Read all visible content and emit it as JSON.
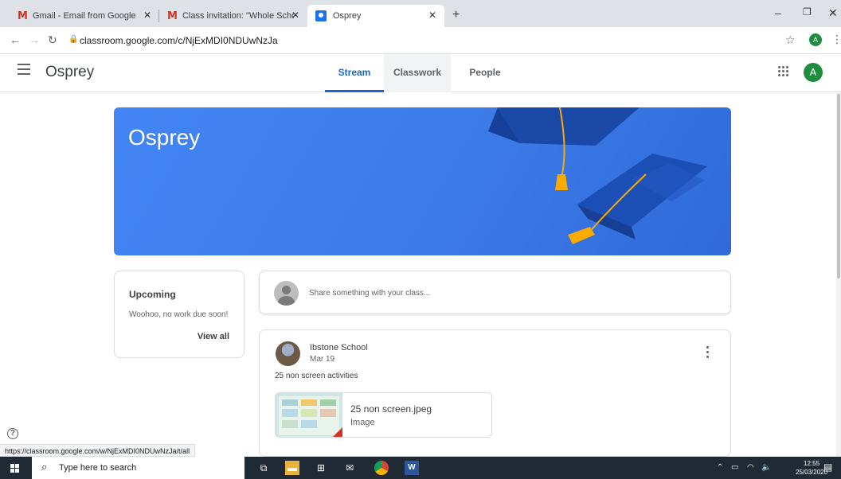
{
  "browser": {
    "tabs": [
      {
        "title": "Gmail - Email from Google",
        "icon": "gmail-icon"
      },
      {
        "title": "Class invitation: \"Whole School\" -",
        "icon": "gmail-icon"
      },
      {
        "title": "Osprey",
        "icon": "classroom-icon",
        "active": true
      }
    ],
    "new_tab": "+",
    "url": "classroom.google.com/c/NjExMDI0NDUwNzJa",
    "profile_initial": "A"
  },
  "header": {
    "class_name": "Osprey",
    "tabs": [
      {
        "label": "Stream",
        "active": true
      },
      {
        "label": "Classwork"
      },
      {
        "label": "People"
      }
    ],
    "avatar_initial": "A"
  },
  "banner": {
    "title": "Osprey"
  },
  "upcoming": {
    "heading": "Upcoming",
    "message": "Woohoo, no work due soon!",
    "view_all": "View all"
  },
  "share": {
    "placeholder": "Share something with your class..."
  },
  "post": {
    "author": "Ibstone School",
    "date": "Mar 19",
    "text": "25 non screen activities",
    "attachment": {
      "name": "25 non screen.jpeg",
      "type": "Image"
    }
  },
  "status_url": "https://classroom.google.com/w/NjExMDI0NDUwNzJa/t/all",
  "taskbar": {
    "search_placeholder": "Type here to search",
    "time": "12:55",
    "date": "25/03/2020"
  },
  "colors": {
    "accent": "#1967d2",
    "banner": "#4285f4",
    "avatar": "#1e8e3e"
  }
}
